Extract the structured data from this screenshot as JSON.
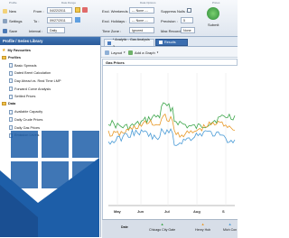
{
  "ribbon": {
    "groups": [
      "Profile",
      "Date Range",
      "Data Options",
      "Prices"
    ],
    "new_label": "New",
    "settings_label": "Settings",
    "save_label": "Save",
    "from_label": "From :",
    "from_value": "04/22/2011",
    "to_label": "To :",
    "to_value": "09/27/2011",
    "interval_label": "Interval :",
    "interval_value": "Daily",
    "excl_weekends_label": "Excl. Weekends :",
    "excl_weekends_value": "--- None ---",
    "excl_holidays_label": "Excl. Holidays :",
    "excl_holidays_value": "--- None ---",
    "timezone_label": "Time Zone :",
    "timezone_value": "Ignored",
    "suppress_label": "Suppress Nulls :",
    "precision_label": "Precision :",
    "precision_value": "5",
    "maxrecords_label": "Max Records :",
    "maxrecords_value": "None",
    "submit_label": "Submit"
  },
  "left": {
    "header": "Profile / Series Library",
    "tree": [
      {
        "label": "My Favourites",
        "kind": "star"
      },
      {
        "label": "Profiles",
        "kind": "folder"
      },
      {
        "label": "Basic Spreads",
        "kind": "doc"
      },
      {
        "label": "Dated Brent Calculation",
        "kind": "doc"
      },
      {
        "label": "Day Ahead vs. Real Time LMP",
        "kind": "doc"
      },
      {
        "label": "Forward Curve Analysis",
        "kind": "doc"
      },
      {
        "label": "Settled Prices",
        "kind": "doc"
      },
      {
        "label": "Data",
        "kind": "folder"
      },
      {
        "label": "Available Capacity",
        "kind": "doc"
      },
      {
        "label": "Daily Crude Prices",
        "kind": "doc"
      },
      {
        "label": "Daily Gas Prices",
        "kind": "doc"
      },
      {
        "label": "Emission Levels",
        "kind": "doc"
      }
    ]
  },
  "tabs": [
    {
      "label": "* Analytic - Gas Analysis 2"
    },
    {
      "label": "Results"
    }
  ],
  "toolbar2": {
    "layout_label": "Layout",
    "addgraph_label": "Add a Graph"
  },
  "chart_title": "Gas Prices",
  "chart_data": {
    "type": "line",
    "title": "Gas Prices",
    "x": [
      "May",
      "Jun",
      "Jul",
      "Aug",
      "S"
    ],
    "series": [
      {
        "name": "Chicago City Gate",
        "color": "#3da64b"
      },
      {
        "name": "Henry Hub",
        "color": "#e89a2a"
      },
      {
        "name": "Mich Con",
        "color": "#4a9bd6"
      }
    ],
    "legend_position": "bottom"
  },
  "legend_header": "Date",
  "colors": {
    "ribbon_bg": "#e4ebf3",
    "panel_header": "#2f62a3",
    "logo_blue": "#1d5ea8",
    "legend_bg": "#d7dee8"
  }
}
